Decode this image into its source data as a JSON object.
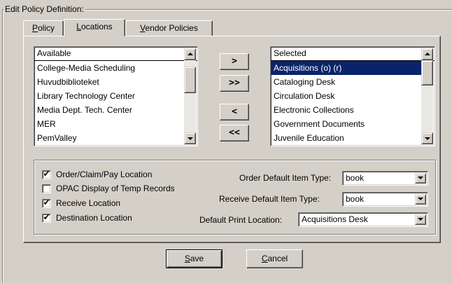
{
  "group_title": "Edit  Policy Definition:",
  "tabs": [
    {
      "label": "Policy",
      "mnemonic": "P",
      "rest": "olicy",
      "active": false
    },
    {
      "label": "Locations",
      "mnemonic": "L",
      "rest": "ocations",
      "active": true
    },
    {
      "label": "Vendor Policies",
      "mnemonic": "V",
      "rest": "endor Policies",
      "active": false
    }
  ],
  "available_list": {
    "header": "Available",
    "items": [
      "College-Media Scheduling",
      "Huvudbiblioteket",
      "Library Technology Center",
      "Media Dept. Tech. Center",
      "MER",
      "PemValley"
    ]
  },
  "selected_list": {
    "header": "Selected",
    "items": [
      "Acquisitions (o) (r)",
      "Cataloging Desk",
      "Circulation Desk",
      "Electronic Collections",
      "Government Documents",
      "Juvenile Education"
    ],
    "selected_index": 0
  },
  "move_buttons": {
    "add": ">",
    "add_all": ">>",
    "remove": "<",
    "remove_all": "<<"
  },
  "checkboxes": [
    {
      "label": "Order/Claim/Pay Location",
      "checked": true
    },
    {
      "label": "OPAC Display of Temp Records",
      "checked": false
    },
    {
      "label": "Receive Location",
      "checked": true
    },
    {
      "label": "Destination Location",
      "checked": true
    }
  ],
  "check_mark": "✔",
  "fields": {
    "order_type_label": "Order Default Item Type:",
    "order_type_value": "book",
    "receive_type_label": "Receive Default Item Type:",
    "receive_type_value": "book",
    "print_location_label": "Default Print Location:",
    "print_location_value": "Acquisitions Desk"
  },
  "buttons": {
    "save_mnemonic": "S",
    "save_rest": "ave",
    "cancel_mnemonic": "C",
    "cancel_rest": "ancel"
  },
  "colors": {
    "face": "#d4d0c8",
    "selection": "#0a246a"
  }
}
